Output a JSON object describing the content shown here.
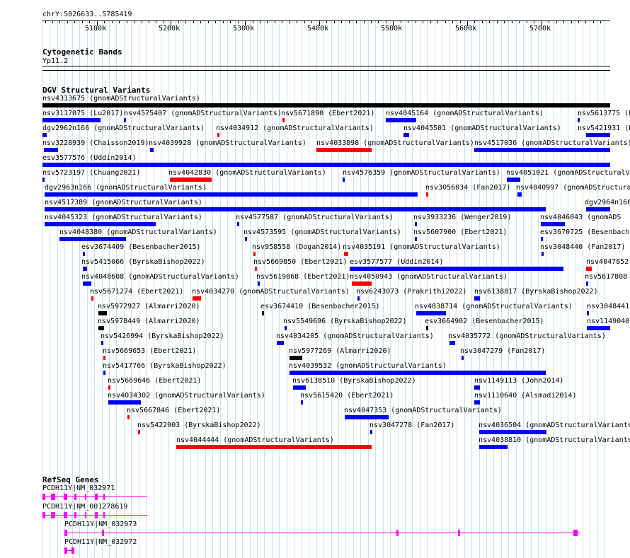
{
  "position": "chrY:5026633..5785419",
  "ruler_ticks": [
    "5100k",
    "5200k",
    "5300k",
    "5400k",
    "5500k",
    "5600k",
    "5700k"
  ],
  "tracks": {
    "cytoband": {
      "title": "Cytogenetic Bands",
      "band": "Yp11.2"
    },
    "dgv": {
      "title": "DGV Structural Variants"
    },
    "refseq": {
      "title": "RefSeq Genes"
    }
  },
  "colors": {
    "loss": "#ff0000",
    "gain": "#0000ff",
    "complex": "#000000",
    "gene": "#ff00ff",
    "grid": "#c6e3ef"
  },
  "dgv_features": [
    {
      "label": "nsv4313675 (gnomADStructuralVariants)"
    },
    {
      "label": "nsv3117075 (Lu2017)"
    },
    {
      "label": "nsv4575407 (gnomADStructuralVariants)"
    },
    {
      "label": "nsv5671890 (Ebert2021)"
    },
    {
      "label": "nsv4045164 (gnomADStructuralVariants)"
    },
    {
      "label": "nsv5613775 (Eb"
    },
    {
      "label": "dgv2962n166 (gnomADStructuralVariants)"
    },
    {
      "label": "nsv4034912 (gnomADStructuralVariants)"
    },
    {
      "label": "nsv4045501 (gnomADStructuralVariants)"
    },
    {
      "label": "nsv5421931 (B"
    },
    {
      "label": "nsv3228939 (Chaisson2019)"
    },
    {
      "label": "nsv4039928 (gnomADStructuralVariants)"
    },
    {
      "label": "nsv4033898 (gnomADStructuralVariants)"
    },
    {
      "label": "nsv4517036 (gnomADStructuralVariants)"
    },
    {
      "label": "esv3577576 (Uddin2014)"
    },
    {
      "label": "nsv5723197 (Chuang2021)"
    },
    {
      "label": "nsv4042830 (gnomADStructuralVariants)"
    },
    {
      "label": "nsv4576359 (gnomADStructuralVariants)"
    },
    {
      "label": "nsv4051021 (gnomADStructuralV"
    },
    {
      "label": "dgv2963n166 (gnomADStructuralVariants)"
    },
    {
      "label": "nsv3056034 (Fan2017)"
    },
    {
      "label": "nsv4040997 (gnomADStructuralVa"
    },
    {
      "label": "nsv4517389 (gnomADStructuralVariants)"
    },
    {
      "label": "dgv2964n166"
    },
    {
      "label": "nsv4045323 (gnomADStructuralVariants)"
    },
    {
      "label": "nsv4577587 (gnomADStructuralVariants)"
    },
    {
      "label": "nsv3933236 (Wenger2019)"
    },
    {
      "label": "nsv4046043 (gnomADS"
    },
    {
      "label": "nsv4048380 (gnomADStructuralVariants)"
    },
    {
      "label": "nsv4573595 (gnomADStructuralVariants)"
    },
    {
      "label": "nsv5607900 (Ebert2021)"
    },
    {
      "label": "esv3670725 (Besenbacher"
    },
    {
      "label": "esv3674409 (Besenbacher2015)"
    },
    {
      "label": "nsv958558 (Dogan2014)"
    },
    {
      "label": "nsv4035191 (gnomADStructuralVariants)"
    },
    {
      "label": "nsv3048440 (Fan2017)"
    },
    {
      "label": "nsv5415066 (ByrskaBishop2022)"
    },
    {
      "label": "nsv5669850 (Ebert2021)"
    },
    {
      "label": "esv3577577 (Uddin2014)"
    },
    {
      "label": "nsv4047852 ("
    },
    {
      "label": "nsv4048608 (gnomADStructuralVariants)"
    },
    {
      "label": "nsv5619868 (Ebert2021)"
    },
    {
      "label": "nsv4050943 (gnomADStructuralVariants)"
    },
    {
      "label": "nsv5617808 ("
    },
    {
      "label": "nsv5671274 (Ebert2021)"
    },
    {
      "label": "nsv4034270 (gnomADStructuralVariants)"
    },
    {
      "label": "nsv6243073 (Prakrithi2022)"
    },
    {
      "label": "nsv6138817 (ByrskaBishop2022)"
    },
    {
      "label": "nsv5972927 (Almarri2020)"
    },
    {
      "label": "esv3674410 (Besenbacher2015)"
    },
    {
      "label": "nsv4038714 (gnomADStructuralVariants)"
    },
    {
      "label": "nsv3048441"
    },
    {
      "label": "nsv5978449 (Almarri2020)"
    },
    {
      "label": "nsv5549696 (ByrskaBishop2022)"
    },
    {
      "label": "esv3664902 (Besenbacher2015)"
    },
    {
      "label": "nsv1149040"
    },
    {
      "label": "nsv5426994 (ByrskaBishop2022)"
    },
    {
      "label": "nsv4034205 (gnomADStructuralVariants)"
    },
    {
      "label": "nsv4035772 (gnomADStructuralVariants)"
    },
    {
      "label": "nsv5669653 (Ebert2021)"
    },
    {
      "label": "nsv5977269 (Almarri2020)"
    },
    {
      "label": "nsv3047279 (Fan2017)"
    },
    {
      "label": "nsv5417766 (ByrskaBishop2022)"
    },
    {
      "label": "nsv4039532 (gnomADStructuralVariants)"
    },
    {
      "label": "nsv5669646 (Ebert2021)"
    },
    {
      "label": "nsv6138510 (ByrskaBishop2022)"
    },
    {
      "label": "nsv1149113 (John2014)"
    },
    {
      "label": "nsv4034302 (gnomADStructuralVariants)"
    },
    {
      "label": "nsv5615420 (Ebert2021)"
    },
    {
      "label": "nsv1110640 (Alsmadi2014)"
    },
    {
      "label": "nsv5667846 (Ebert2021)"
    },
    {
      "label": "nsv4047353 (gnomADStructuralVariants)"
    },
    {
      "label": "nsv5422903 (ByrskaBishop2022)"
    },
    {
      "label": "nsv3047278 (Fan2017)"
    },
    {
      "label": "nsv4036504 (gnomADStructuralVariants"
    },
    {
      "label": "nsv4044444 (gnomADStructuralVariants)"
    },
    {
      "label": "nsv4038810 (gnomADStructuralVariants"
    }
  ],
  "genes": [
    {
      "label": "PCDH11Y|NM_032971"
    },
    {
      "label": "PCDH11Y|NM_001278619"
    },
    {
      "label": "PCDH11Y|NM_032973"
    },
    {
      "label": "PCDH11Y|NM_032972"
    }
  ]
}
